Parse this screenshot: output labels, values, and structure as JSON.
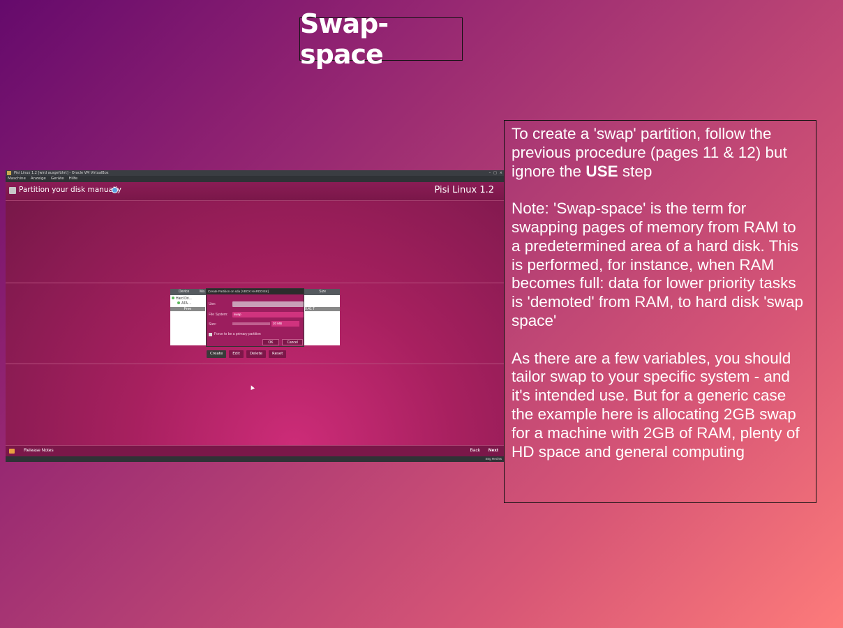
{
  "slide": {
    "title": "Swap-space",
    "paragraph1_part1": "To create a 'swap' partition, follow the previous procedure (pages 11 & 12) but ignore the ",
    "paragraph1_bold": "USE",
    "paragraph1_part2": " step",
    "paragraph2": "Note: 'Swap-space' is the term for swapping pages of memory from RAM to a predetermined area of a hard disk. This is performed, for instance, when RAM becomes full: data for lower priority tasks is 'demoted' from RAM, to hard disk 'swap space'",
    "paragraph3": "As there are a few variables, you should tailor swap to your specific system - and it's intended use. But for a generic case the example here is allocating 2GB swap for a machine with 2GB of RAM, plenty of HD space and general computing"
  },
  "screenshot": {
    "window_title": "Pisi Linux 1.2 [wird ausgeführt] - Oracle VM VirtualBox",
    "window_controls": [
      "–",
      "□",
      "×"
    ],
    "menu": [
      "Maschine",
      "Anzeige",
      "Geräte",
      "Hilfe"
    ],
    "header_title": "Partition your disk manually",
    "brand": "Pisi Linux 1.2",
    "table": {
      "col_device": "Device",
      "col_ma": "Ma",
      "col_size": "Size",
      "rows": [
        "Hard Dri...",
        "ATA ..."
      ],
      "free": "Free",
      "size_value": "0.41 T"
    },
    "dialog": {
      "title": "Create Partition on sda (VBOX HARDDISK)",
      "use_label": "Use:",
      "fs_label": "File System:",
      "fs_value": "swap",
      "size_label": "Size:",
      "size_value": "20 MB",
      "primary_label": "Force to be a primary partition",
      "ok": "OK",
      "cancel": "Cancel"
    },
    "actions": {
      "create": "Create",
      "edit": "Edit",
      "delete": "Delete",
      "reset": "Reset"
    },
    "footer": {
      "release_notes": "Release Notes",
      "back": "Back",
      "next": "Next"
    },
    "status_text": "Strg Rechts"
  },
  "colors": {
    "gradient_start": "#650a6c",
    "gradient_end": "#fd7b7a",
    "app_magenta": "#a7205f"
  }
}
